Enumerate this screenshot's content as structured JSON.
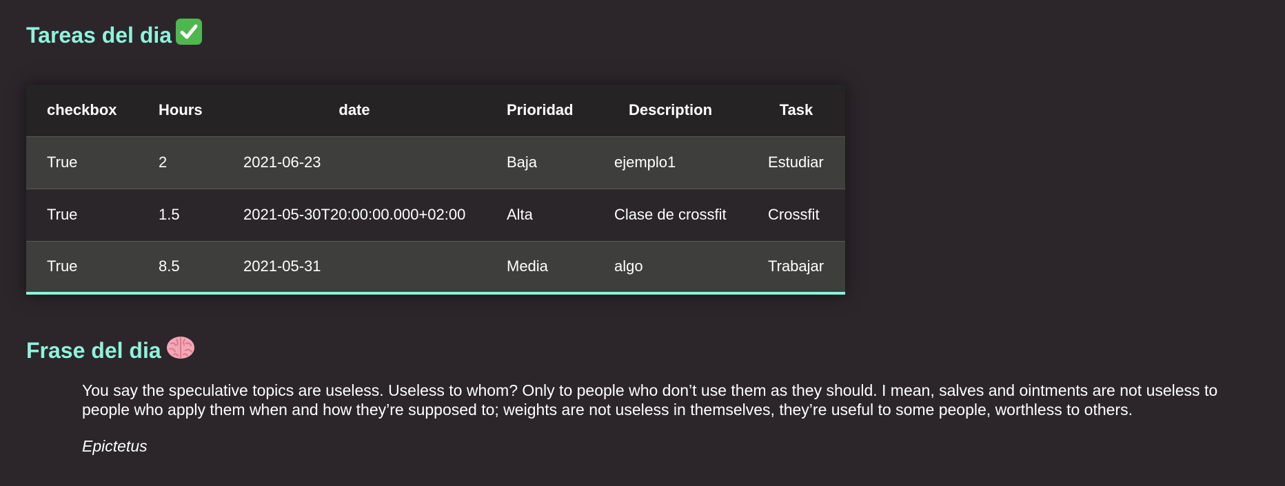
{
  "tasks_section": {
    "title": "Tareas del dia",
    "icon": "check-mark-emoji",
    "accent_color": "#8ff2dc"
  },
  "table": {
    "headers": [
      "checkbox",
      "Hours",
      "date",
      "Prioridad",
      "Description",
      "Task"
    ],
    "rows": [
      [
        "True",
        "2",
        "2021-06-23",
        "Baja",
        "ejemplo1",
        "Estudiar"
      ],
      [
        "True",
        "1.5",
        "2021-05-30T20:00:00.000+02:00",
        "Alta",
        "Clase de crossfit",
        "Crossfit"
      ],
      [
        "True",
        "8.5",
        "2021-05-31",
        "Media",
        "algo",
        "Trabajar"
      ]
    ]
  },
  "quote_section": {
    "title": "Frase del dia",
    "icon": "brain-emoji",
    "text": "You say the speculative topics are useless. Useless to whom? Only to people who don’t use them as they should. I mean, salves and ointments are not useless to people who apply them when and how they’re supposed to; weights are not useless in themselves, they’re useful to some people, worthless to others.",
    "author": "Epictetus"
  }
}
